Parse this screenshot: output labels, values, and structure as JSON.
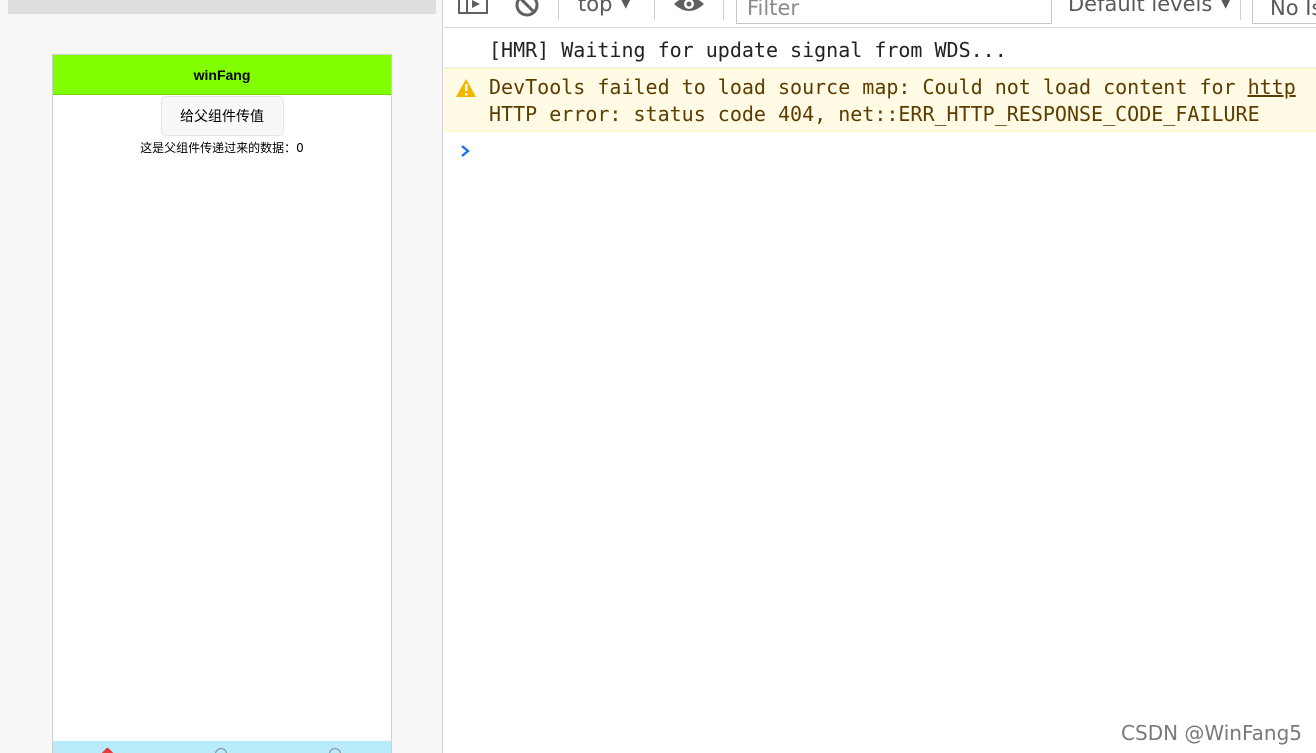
{
  "simulator": {
    "nav_title": "winFang",
    "child_button_label": "给父组件传值",
    "data_text": "这是父组件传递过来的数据：0",
    "nav_color": "#7fff00",
    "tabbar_color": "#b8ecfb"
  },
  "devtools": {
    "context_label": "top",
    "filter_placeholder": "Filter",
    "levels_label": "Default levels",
    "issues_label": "No Issues",
    "icons": {
      "sidebar": "sidebar-toggle-icon",
      "clear": "clear-console-icon",
      "eye": "live-expression-icon",
      "warn": "warning-icon",
      "prompt": "console-prompt-icon"
    },
    "messages": [
      {
        "type": "log",
        "text": "[HMR] Waiting for update signal from WDS..."
      },
      {
        "type": "warning",
        "line1_prefix": "DevTools failed to load source map: Could not load content for ",
        "line1_link": "http",
        "line2": "HTTP error: status code 404, net::ERR_HTTP_RESPONSE_CODE_FAILURE"
      }
    ]
  },
  "watermark": "CSDN @WinFang5"
}
